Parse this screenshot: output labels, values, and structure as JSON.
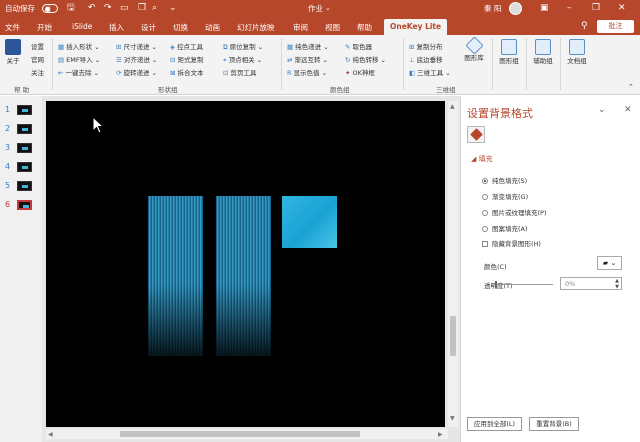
{
  "titlebar": {
    "autosave_label": "自动保存",
    "toggle_state": "关",
    "doc_name": "作业",
    "user_name": "秦 阳"
  },
  "tabs": [
    "文件",
    "开始",
    "iSlide",
    "插入",
    "设计",
    "切换",
    "动画",
    "幻灯片放映",
    "审阅",
    "视图",
    "帮助",
    "OneKey Lite"
  ],
  "active_tab": "OneKey Lite",
  "share_label": "批注",
  "ribbon": {
    "help_group": {
      "about": "关于",
      "settings": "设置",
      "site": "官网",
      "follow": "关注",
      "label": "帮 助"
    },
    "shape_group": {
      "insert_shape": "插入形状",
      "emf_import": "EMF导入",
      "one_key_remove": "一键去除",
      "size_increment": "尺寸递进",
      "align_increment": "对齐递进",
      "rotate_increment": "旋转递进",
      "control_tool": "控点工具",
      "matrix_copy": "矩式复制",
      "split_text": "拆合文本",
      "origin_copy": "原位复制",
      "vertex_related": "顶点相关",
      "clip_tool": "剪页工具",
      "label": "形状组"
    },
    "color_group": {
      "color_increment": "纯色递进",
      "gradient_swap": "渐远互转",
      "display_color": "显示色值",
      "picker": "取色器",
      "color_transform": "纯色转移",
      "ok_artboard": "OK神框",
      "label": "颜色组"
    },
    "three_d_group": {
      "copy_distribute": "复制分布",
      "bottom_change": "底边垂移",
      "three_d_tool": "三维工具",
      "label": "三维组"
    },
    "big_buttons": {
      "shape_lib": "图形库",
      "image_group": "图形组",
      "aux_group": "辅助组",
      "doc_group": "文档组"
    }
  },
  "slides": [
    {
      "num": "1"
    },
    {
      "num": "2"
    },
    {
      "num": "3"
    },
    {
      "num": "4"
    },
    {
      "num": "5"
    },
    {
      "num": "6"
    }
  ],
  "active_slide": "6",
  "format_pane": {
    "title": "设置背景格式",
    "section": "填充",
    "options": [
      {
        "label": "纯色填充(S)",
        "selected": true
      },
      {
        "label": "渐变填充(G)",
        "selected": false
      },
      {
        "label": "图片或纹理填充(P)",
        "selected": false
      },
      {
        "label": "图案填充(A)",
        "selected": false
      }
    ],
    "hide_bg_label": "隐藏背景图形(H)",
    "color_label": "颜色(C)",
    "transparency_label": "透明度(T)",
    "transparency_value": "0%",
    "apply_all": "应用到全部(L)",
    "reset_bg": "重置背景(B)"
  },
  "colors": {
    "accent": "#b7472a",
    "slide_bg": "#000000",
    "shape_cyan": "#2ab3e0"
  }
}
